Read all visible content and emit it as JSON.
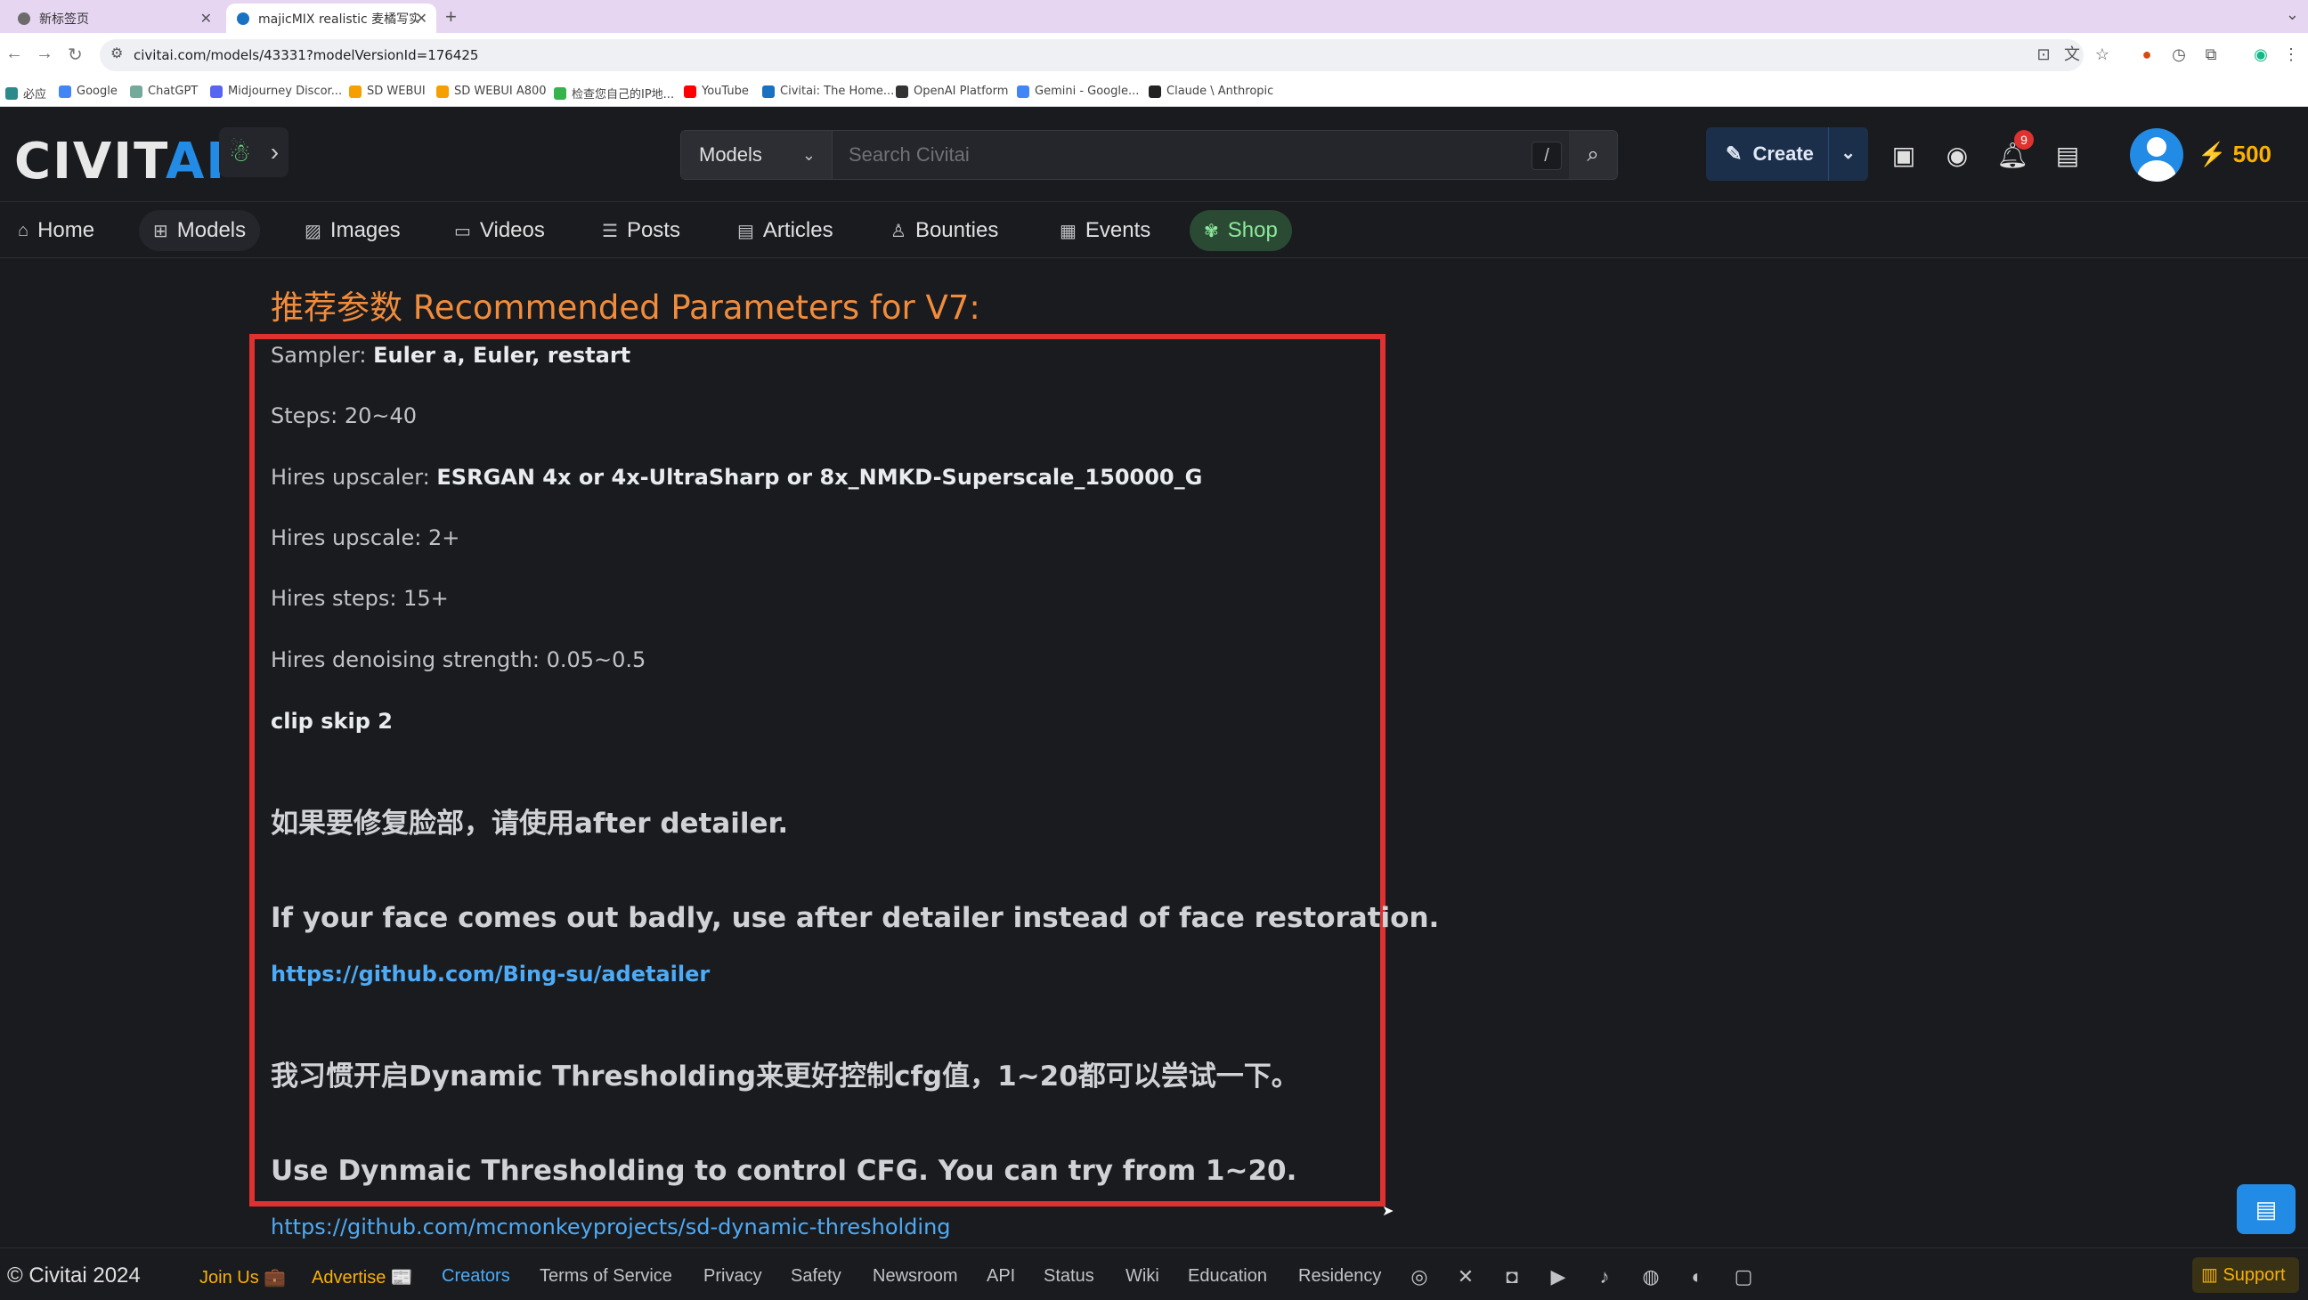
{
  "browser": {
    "tabs": [
      {
        "title": "新标签页"
      },
      {
        "title": "majicMIX realistic 麦橘写实 - ..."
      }
    ],
    "url": "civitai.com/models/43331?modelVersionId=176425",
    "bookmarks": [
      "必应",
      "Google",
      "ChatGPT",
      "Midjourney Discor...",
      "SD WEBUI",
      "SD WEBUI A800",
      "检查您自己的IP地...",
      "YouTube",
      "Civitai: The Home...",
      "OpenAI Platform",
      "Gemini - Google...",
      "Claude \\ Anthropic"
    ]
  },
  "header": {
    "logo_left": "CIVIT",
    "logo_right": "AI",
    "search_scope": "Models",
    "search_placeholder": "Search Civitai",
    "search_shortcut": "/",
    "create_label": "Create",
    "notification_count": "9",
    "buzz_amount": "500"
  },
  "nav": {
    "items": [
      {
        "label": "Home",
        "icon": "home-icon"
      },
      {
        "label": "Models",
        "icon": "grid-icon"
      },
      {
        "label": "Images",
        "icon": "image-icon"
      },
      {
        "label": "Videos",
        "icon": "video-icon"
      },
      {
        "label": "Posts",
        "icon": "posts-icon"
      },
      {
        "label": "Articles",
        "icon": "article-icon"
      },
      {
        "label": "Bounties",
        "icon": "bounty-icon"
      },
      {
        "label": "Events",
        "icon": "calendar-icon"
      },
      {
        "label": "Shop",
        "icon": "shop-icon"
      }
    ],
    "active": "Models"
  },
  "content": {
    "heading": "推荐参数 Recommended Parameters for V7:",
    "params": [
      {
        "label": "Sampler: ",
        "value": "Euler a, Euler, restart",
        "bold": true
      },
      {
        "label": "Steps: ",
        "value": "20~40",
        "bold": false
      },
      {
        "label": "Hires upscaler: ",
        "value": "ESRGAN 4x or 4x-UltraSharp or 8x_NMKD-Superscale_150000_G",
        "bold": true
      },
      {
        "label": "Hires upscale: ",
        "value": "2+",
        "bold": false
      },
      {
        "label": "Hires steps: ",
        "value": "15+",
        "bold": false
      },
      {
        "label": "Hires denoising strength: ",
        "value": "0.05~0.5",
        "bold": false
      }
    ],
    "clip_skip": "clip skip 2",
    "face_zh": "如果要修复脸部，请使用after detailer.",
    "face_en": "If your face comes out badly, use after detailer instead of face restoration.",
    "adetailer_link": "https://github.com/Bing-su/adetailer",
    "dyn_zh": "我习惯开启Dynamic Thresholding来更好控制cfg值，1~20都可以尝试一下。",
    "dyn_en": "Use Dynmaic Thresholding to control CFG. You can try from 1~20.",
    "dyn_link": "https://github.com/mcmonkeyprojects/sd-dynamic-thresholding"
  },
  "footer": {
    "copyright": "© Civitai 2024",
    "links": [
      "Join Us 💼",
      "Advertise 📰",
      "Creators",
      "Terms of Service",
      "Privacy",
      "Safety",
      "Newsroom",
      "API",
      "Status",
      "Wiki",
      "Education",
      "Residency"
    ],
    "support_label": "Support"
  },
  "colors": {
    "accent": "#228be6",
    "heading": "#f08c3c",
    "highlight_box": "#e03131",
    "buzz": "#fab005"
  }
}
